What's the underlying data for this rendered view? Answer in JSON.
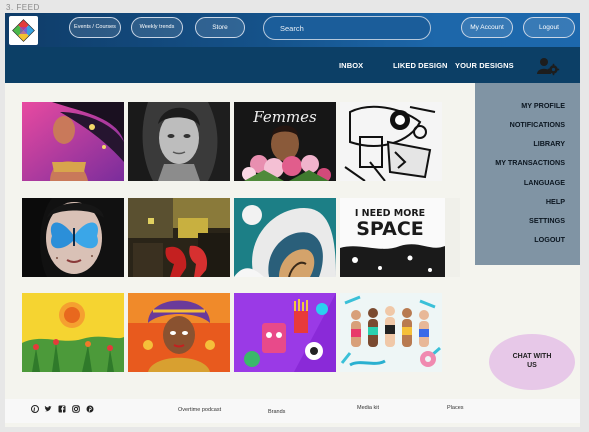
{
  "frame_label": "3. FEED",
  "topbar": {
    "events_courses": "Events / Courses",
    "weekly_trends": "Weekly trends",
    "store": "Store",
    "search_placeholder": "Search",
    "my_account": "My Account",
    "logout": "Logout"
  },
  "subnav": {
    "inbox": "INBOX",
    "liked_design": "LIKED DESIGN",
    "your_designs": "YOUR DESIGNS"
  },
  "tiles": [
    {
      "id": "pocahontas-portrait",
      "icon": "illustration"
    },
    {
      "id": "bw-portrait",
      "icon": "illustration"
    },
    {
      "id": "femmes-tulips",
      "icon": "illustration",
      "caption": "Femmes"
    },
    {
      "id": "bw-comic-collage",
      "icon": "illustration"
    },
    {
      "id": "butterfly-face",
      "icon": "illustration"
    },
    {
      "id": "red-heels-collage",
      "icon": "illustration"
    },
    {
      "id": "wave-dolphin",
      "icon": "illustration"
    },
    {
      "id": "need-more-space",
      "icon": "illustration",
      "caption": "I NEED MORE SPACE"
    },
    {
      "id": "sunflower-field",
      "icon": "illustration"
    },
    {
      "id": "goddess-headdress",
      "icon": "illustration"
    },
    {
      "id": "purple-cartoon-snacks",
      "icon": "illustration"
    },
    {
      "id": "swimsuit-women",
      "icon": "illustration"
    }
  ],
  "dropdown": {
    "items": [
      "MY PROFILE",
      "NOTIFICATIONS",
      "LIBRARY",
      "MY TRANSACTIONS",
      "LANGUAGE",
      "HELP",
      "SETTINGS",
      "LOGOUT"
    ]
  },
  "chat": {
    "label": "CHAT WITH US"
  },
  "footer": {
    "social_icons": [
      "pinterest-icon",
      "twitter-icon",
      "facebook-icon",
      "instagram-icon",
      "pinterest-icon"
    ],
    "links": [
      "Overtime podcast",
      "Brands",
      "Media kit",
      "Places"
    ]
  },
  "colors": {
    "topbar": "#15528a",
    "subnav": "#0c3f66",
    "dropdown": "#8094a4",
    "chat": "#e7c8e8",
    "background": "#f4f4ee"
  }
}
